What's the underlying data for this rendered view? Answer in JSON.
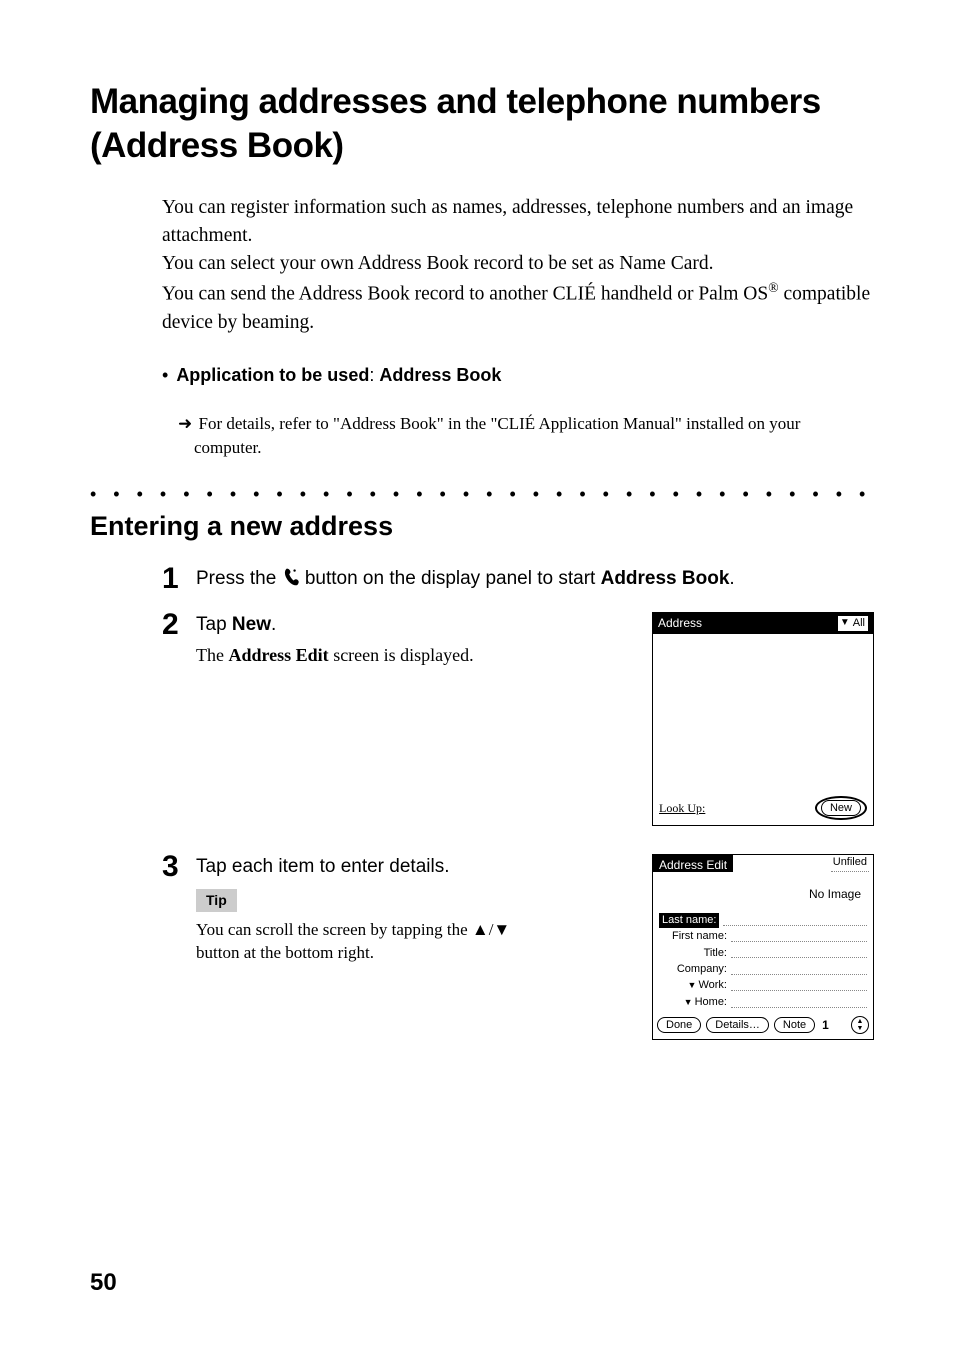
{
  "title": "Managing addresses and telephone numbers (Address Book)",
  "intro": {
    "p1": "You can register information such as names, addresses, telephone numbers and an image attachment.",
    "p2": "You can select your own Address Book record to be set as Name Card.",
    "p3a": "You can send the Address Book record to another CLIÉ handheld or Palm OS",
    "p3b": " compatible device by beaming."
  },
  "app_line": {
    "label": "Application to be used",
    "value": "Address Book"
  },
  "detail_ref": "For details, refer to \"Address Book\" in the \"CLIÉ Application Manual\" installed on your computer.",
  "section": "Entering a new address",
  "steps": {
    "s1_a": "Press the ",
    "s1_b": " button on the display panel to start ",
    "s1_c": "Address Book",
    "s1_d": ".",
    "s2_a": "Tap ",
    "s2_b": "New",
    "s2_c": ".",
    "s2_sub_a": "The ",
    "s2_sub_b": "Address Edit",
    "s2_sub_c": " screen is displayed.",
    "s3": "Tap each item to enter details."
  },
  "tip": {
    "label": "Tip",
    "text": "You can scroll the screen by tapping the ▲/▼ button at the bottom right."
  },
  "screenshot1": {
    "title": "Address",
    "category": "All",
    "lookup": "Look Up:",
    "new_btn": "New"
  },
  "screenshot2": {
    "title": "Address Edit",
    "category": "Unfiled",
    "noimage": "No Image",
    "fields": {
      "last": "Last name:",
      "first": "First name:",
      "title": "Title:",
      "company": "Company:",
      "work": "Work:",
      "home": "Home:"
    },
    "buttons": {
      "done": "Done",
      "details": "Details…",
      "note": "Note"
    },
    "page": "1"
  },
  "page_number": "50"
}
